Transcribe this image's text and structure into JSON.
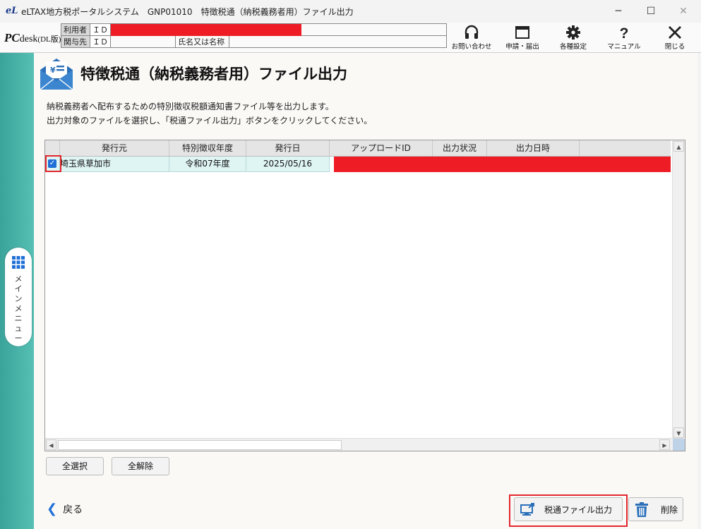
{
  "window": {
    "app_icon_text": "eL",
    "title": "eLTAX地方税ポータルシステム　GNP01010　特徴税通（納税義務者用）ファイル出力",
    "minimize_glyph": "─",
    "maximize_glyph": "☐",
    "close_glyph": "✕"
  },
  "header": {
    "logo_pc": "PC",
    "logo_desk": "desk",
    "logo_edition": "(DL版)",
    "user_label": "利用者",
    "related_label": "関与先",
    "id_label": "ＩＤ",
    "name_label": "氏名又は名称",
    "buttons": [
      {
        "label": "お問い合わせ",
        "icon": "headset-icon"
      },
      {
        "label": "申請・届出",
        "icon": "window-icon"
      },
      {
        "label": "各種設定",
        "icon": "gear-icon"
      },
      {
        "label": "マニュアル",
        "icon": "question-icon"
      },
      {
        "label": "閉じる",
        "icon": "close-icon"
      }
    ]
  },
  "sidebar": {
    "menu_label": "メインメニュー"
  },
  "page": {
    "title": "特徴税通（納税義務者用）ファイル出力",
    "description_line1": "納税義務者へ配布するための特別徴収税額通知書ファイル等を出力します。",
    "description_line2": "出力対象のファイルを選択し、「税通ファイル出力」ボタンをクリックしてください。"
  },
  "table": {
    "columns": [
      "発行元",
      "特別徴収年度",
      "発行日",
      "アップロードID",
      "出力状況",
      "出力日時"
    ],
    "rows": [
      {
        "checked": true,
        "issuer": "埼玉県草加市",
        "year": "令和07年度",
        "date": "2025/05/16",
        "upload_id": "",
        "status": "",
        "output_time": ""
      }
    ]
  },
  "buttons": {
    "select_all": "全選択",
    "deselect_all": "全解除",
    "back": "戻る",
    "output": "税通ファイル出力",
    "delete": "削除"
  },
  "colors": {
    "accent": "#1f6fd6",
    "highlight_red": "#e3262d",
    "sidebar_green": "#45b1a6",
    "selected_row": "#dff5f4"
  }
}
